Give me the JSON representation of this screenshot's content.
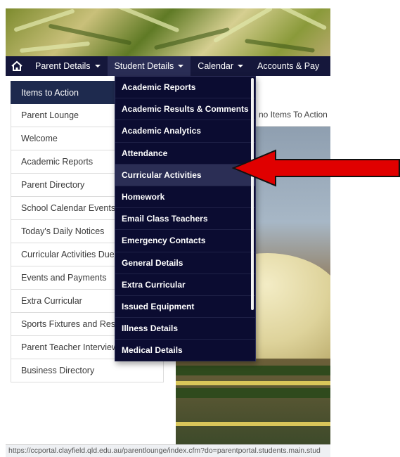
{
  "navbar": {
    "home_icon": "home-icon",
    "items": [
      {
        "label": "Parent Details"
      },
      {
        "label": "Student Details"
      },
      {
        "label": "Calendar"
      },
      {
        "label": "Accounts & Pay"
      }
    ]
  },
  "sidebar": {
    "items": [
      {
        "label": "Items to Action"
      },
      {
        "label": "Parent Lounge"
      },
      {
        "label": "Welcome"
      },
      {
        "label": "Academic Reports"
      },
      {
        "label": "Parent Directory"
      },
      {
        "label": "School Calendar Events"
      },
      {
        "label": "Today's Daily Notices"
      },
      {
        "label": "Curricular Activities Due"
      },
      {
        "label": "Events and Payments"
      },
      {
        "label": "Extra Curricular"
      },
      {
        "label": "Sports Fixtures and Res"
      },
      {
        "label": "Parent Teacher Interview"
      },
      {
        "label": "Business Directory"
      }
    ]
  },
  "main": {
    "message": "no Items To Action"
  },
  "dropdown": {
    "items": [
      {
        "label": "Academic Reports"
      },
      {
        "label": "Academic Results & Comments"
      },
      {
        "label": "Academic Analytics"
      },
      {
        "label": "Attendance"
      },
      {
        "label": "Curricular Activities"
      },
      {
        "label": "Homework"
      },
      {
        "label": "Email Class Teachers"
      },
      {
        "label": "Emergency Contacts"
      },
      {
        "label": "General Details"
      },
      {
        "label": "Extra Curricular"
      },
      {
        "label": "Issued Equipment"
      },
      {
        "label": "Illness Details"
      },
      {
        "label": "Medical Details"
      }
    ]
  },
  "status_bar": {
    "url": "https://ccportal.clayfield.qld.edu.au/parentlounge/index.cfm?do=parentportal.students.main.stud"
  },
  "colors": {
    "navbar": "#15173b",
    "dropdown": "#0b0c31",
    "sidebar_active": "#1e2a4e",
    "arrow": "#e00000"
  }
}
